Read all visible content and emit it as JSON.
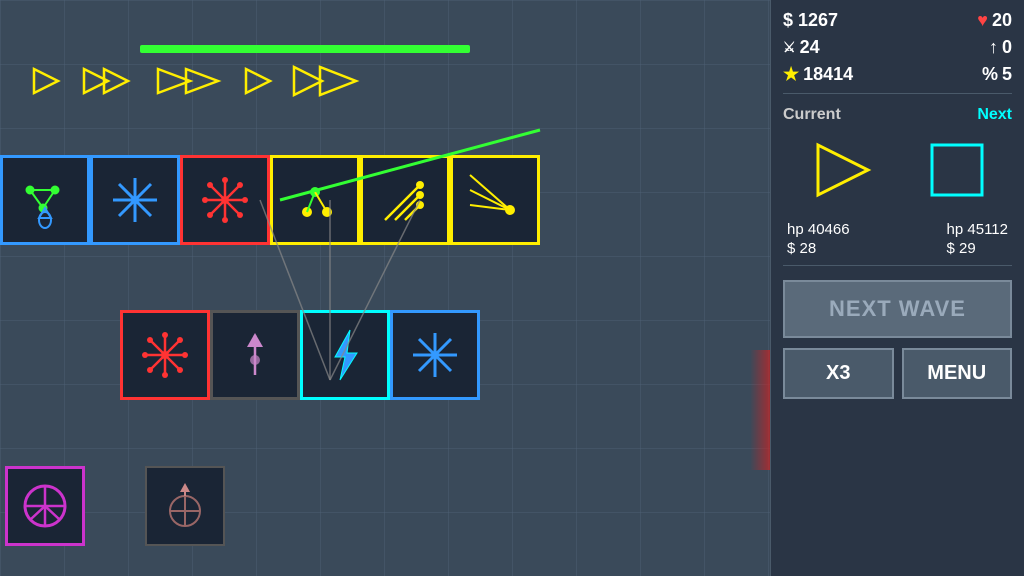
{
  "stats": {
    "money": "$ 1267",
    "hearts": "20",
    "sword": "24",
    "arrow_up": "0",
    "star": "18414",
    "percent": "5",
    "heart_icon": "♥",
    "sword_icon": "⚔",
    "star_icon": "★",
    "percent_icon": "%"
  },
  "labels": {
    "current": "Current",
    "next": "Next",
    "hp_current_label": "hp",
    "hp_current_val": "40466",
    "money_current_label": "$",
    "money_current_val": "28",
    "hp_next_label": "hp",
    "hp_next_val": "45112",
    "money_next_label": "$",
    "money_next_val": "29",
    "next_wave": "NEXT WAVE",
    "x3": "X3",
    "menu": "MENU"
  },
  "enemies": {
    "count_small": 1,
    "count_double": 2,
    "count_large": 2,
    "count_single2": 1,
    "count_double2": 2
  },
  "colors": {
    "accent_yellow": "#ffee00",
    "accent_cyan": "#00ffff",
    "accent_blue": "#3399ff",
    "accent_red": "#ff3333",
    "accent_green": "#33ff33",
    "accent_purple": "#cc33cc",
    "bg_panel": "#2a3545",
    "bg_game": "#3a4a5a"
  }
}
